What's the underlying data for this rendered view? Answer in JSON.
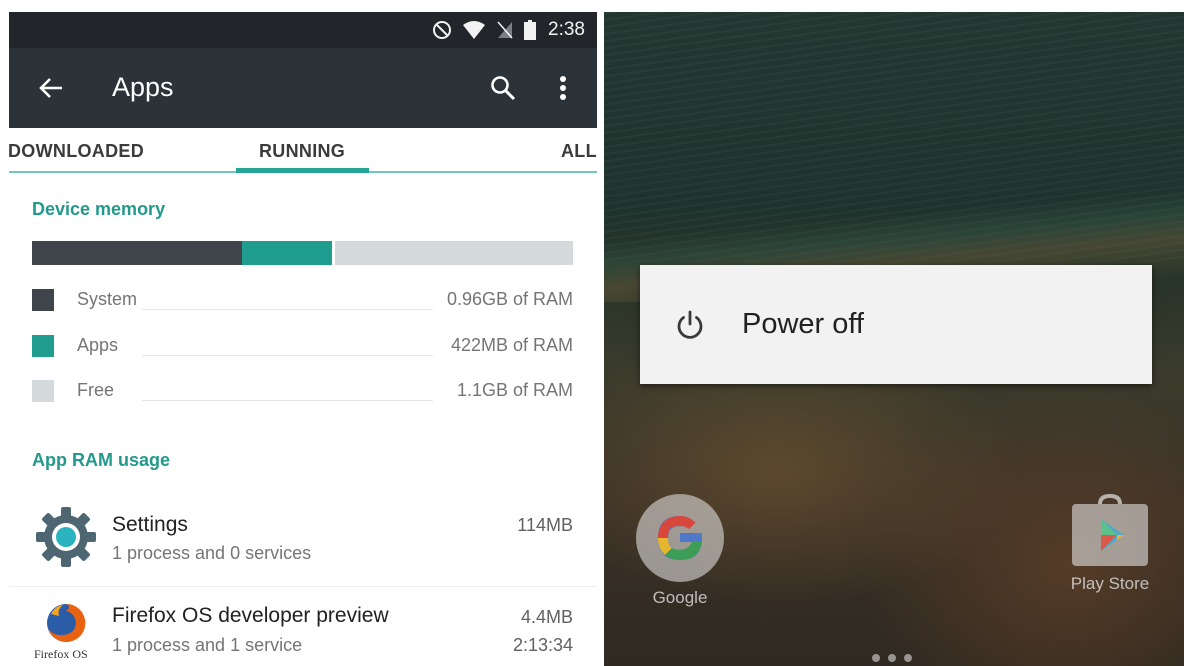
{
  "status_bar": {
    "time": "2:38"
  },
  "toolbar": {
    "title": "Apps"
  },
  "tabs": [
    {
      "label": "DOWNLOADED",
      "selected": false
    },
    {
      "label": "RUNNING",
      "selected": true
    },
    {
      "label": "ALL",
      "selected": false
    }
  ],
  "device_memory": {
    "heading": "Device memory",
    "rows": [
      {
        "label": "System",
        "value": "0.96GB of RAM",
        "color": "#3f454b"
      },
      {
        "label": "Apps",
        "value": "422MB of RAM",
        "color": "#1f9d8f"
      },
      {
        "label": "Free",
        "value": "1.1GB of RAM",
        "color": "#d4d9dc"
      }
    ]
  },
  "app_ram": {
    "heading": "App RAM usage",
    "apps": [
      {
        "name": "Settings",
        "detail": "1 process and 0 services",
        "size": "114MB",
        "icon": "gear-icon"
      },
      {
        "name": "Firefox OS developer preview",
        "detail": "1 process and 1 service",
        "size": "4.4MB",
        "time": "2:13:34",
        "icon_caption": "Firefox OS"
      }
    ]
  },
  "power_menu": {
    "label": "Power off"
  },
  "home_screen": {
    "apps": [
      {
        "label": "Google",
        "icon": "google-icon"
      },
      {
        "label": "Play Store",
        "icon": "play-store-icon"
      }
    ]
  },
  "colors": {
    "accent": "#26a69a",
    "toolbar": "#2c3338",
    "status_bar": "#22262a"
  }
}
